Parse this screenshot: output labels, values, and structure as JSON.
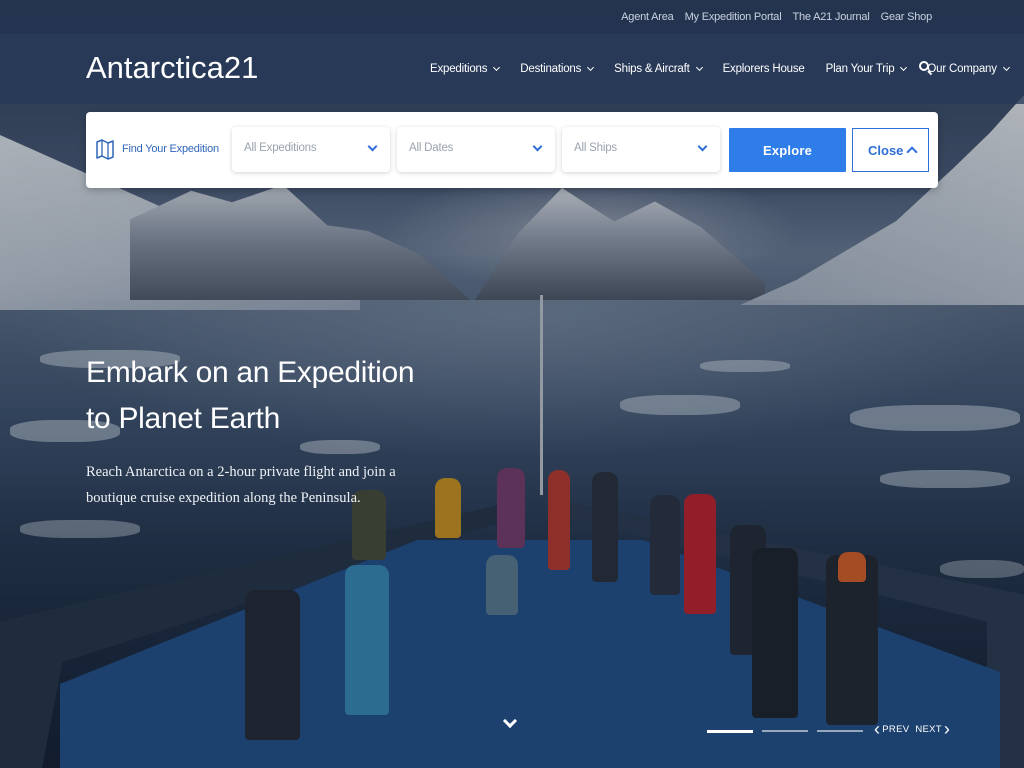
{
  "utility_links": [
    "Agent Area",
    "My Expedition Portal",
    "The A21 Journal",
    "Gear Shop"
  ],
  "logo": "Antarctica21",
  "nav": {
    "items": [
      {
        "label": "Expeditions",
        "dropdown": true
      },
      {
        "label": "Destinations",
        "dropdown": true
      },
      {
        "label": "Ships & Aircraft",
        "dropdown": true
      },
      {
        "label": "Explorers House",
        "dropdown": false
      },
      {
        "label": "Plan Your Trip",
        "dropdown": true
      },
      {
        "label": "Our Company",
        "dropdown": true
      }
    ]
  },
  "search": {
    "find_label": "Find Your Expedition",
    "expeditions_value": "All Expeditions",
    "dates_value": "All Dates",
    "ships_value": "All Ships",
    "explore_label": "Explore",
    "close_label": "Close"
  },
  "hero": {
    "title": "Embark on an Expedition to Planet Earth",
    "subtitle": "Reach Antarctica on a 2-hour private flight and join a boutique cruise expedition along the Peninsula."
  },
  "slider": {
    "active_slide": 1,
    "total_slides": 3,
    "prev_label": "PREV",
    "next_label": "NEXT"
  },
  "colors": {
    "accent": "#2e7de9",
    "nav_bg": "#283a5a",
    "link_blue": "#2f66b8"
  }
}
